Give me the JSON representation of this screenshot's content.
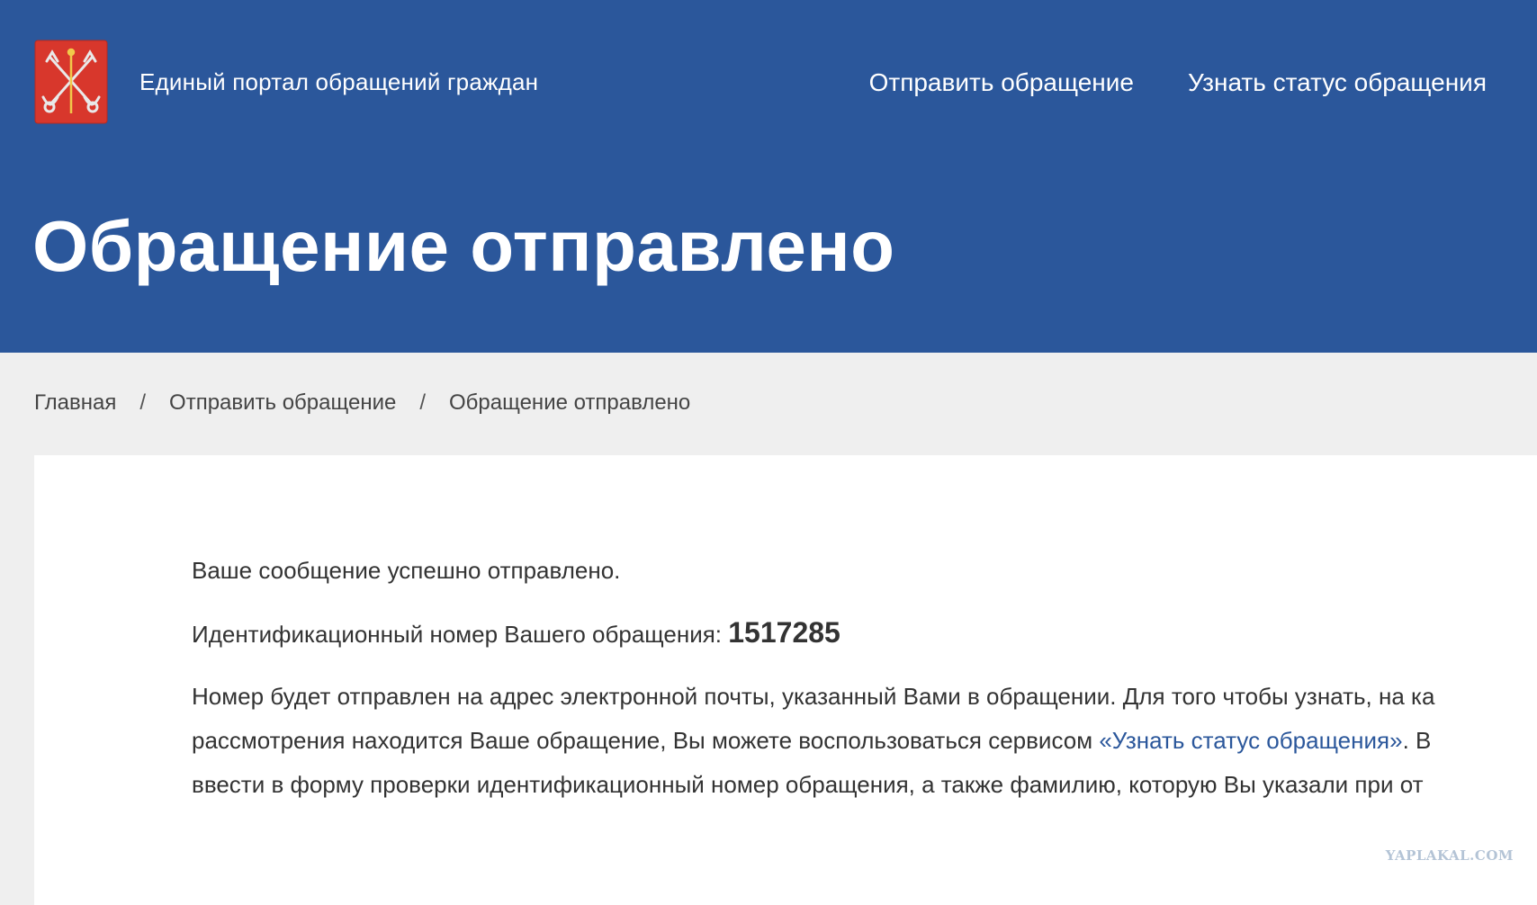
{
  "header": {
    "portal_name": "Единый портал обращений граждан",
    "nav": {
      "send_label": "Отправить обращение",
      "status_label": "Узнать статус обращения"
    },
    "page_title": "Обращение отправлено"
  },
  "breadcrumb": {
    "home": "Главная",
    "send": "Отправить обращение",
    "current": "Обращение отправлено",
    "separator": "/"
  },
  "message": {
    "success": "Ваше сообщение успешно отправлено.",
    "id_label": "Идентификационный номер Вашего обращения: ",
    "id_value": "1517285",
    "info_line1": "Номер будет отправлен на адрес электронной почты, указанный Вами в обращении. Для того чтобы узнать, на ка",
    "info_line2_pre": "рассмотрения находится Ваше обращение, Вы можете воспользоваться сервисом ",
    "info_link": "«Узнать статус обращения»",
    "info_line2_post": ". В",
    "info_line3": "ввести в форму проверки идентификационный номер обращения, а также фамилию, которую Вы указали при от"
  },
  "watermark": "YAPLAKAL.COM",
  "colors": {
    "header_bg": "#2b579b",
    "page_bg": "#efefef",
    "link": "#2b579b",
    "logo_red": "#d8372c"
  },
  "icons": {
    "logo": "saint-petersburg-coat-of-arms-icon"
  }
}
